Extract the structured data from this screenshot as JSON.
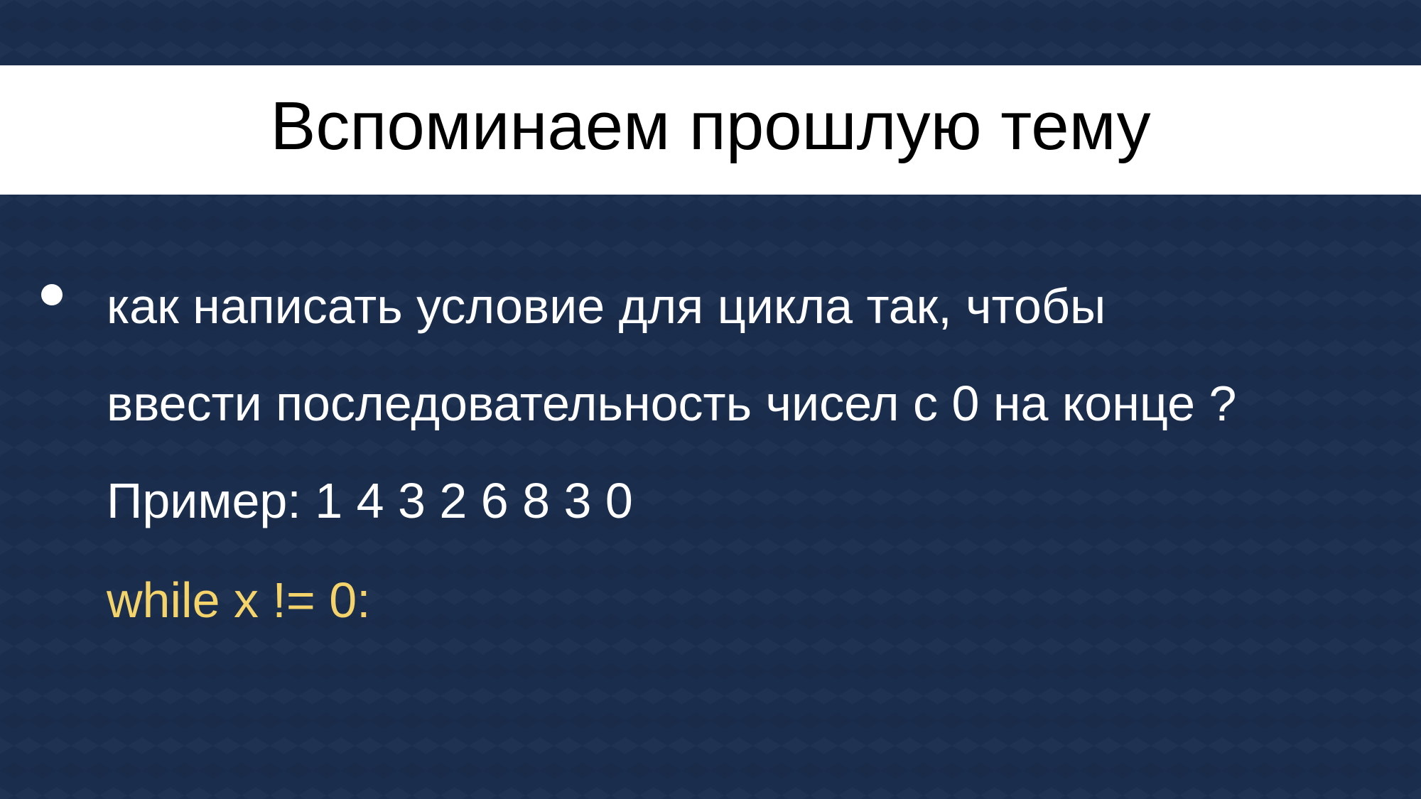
{
  "slide": {
    "title": "Вспоминаем прошлую тему",
    "bullet_line_1": "как написать условие для цикла так, чтобы",
    "bullet_line_2": "ввести последовательность чисел с 0 на конце ?",
    "example_line": "Пример: 1 4 3 2 6 8 3 0",
    "code_line": "while x != 0:"
  },
  "colors": {
    "background": "#1a2d4d",
    "title_band": "#ffffff",
    "text": "#ffffff",
    "code": "#f3d36a"
  }
}
